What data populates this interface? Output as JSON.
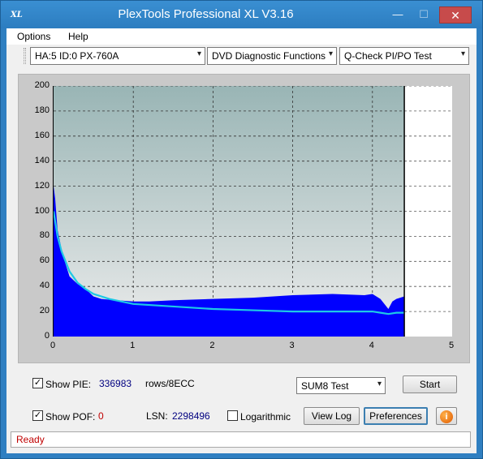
{
  "window": {
    "title": "PlexTools Professional XL V3.16",
    "icon_label": "XL",
    "min_symbol": "—",
    "max_symbol": "☐",
    "close_symbol": "✕"
  },
  "menu": {
    "items": [
      "Options",
      "Help"
    ]
  },
  "toolbar": {
    "drive": "HA:5 ID:0  PX-760A",
    "function": "DVD Diagnostic Functions",
    "test": "Q-Check PI/PO Test",
    "arrow": "▾"
  },
  "chart_data": {
    "type": "area",
    "x_ticks": [
      "0",
      "1",
      "2",
      "3",
      "4",
      "5"
    ],
    "y_ticks": [
      "0",
      "20",
      "40",
      "60",
      "80",
      "100",
      "120",
      "140",
      "160",
      "180",
      "200"
    ],
    "xlim": [
      0,
      5
    ],
    "ylim": [
      0,
      200
    ],
    "grid": true,
    "end_marker_x": 4.4,
    "series": [
      {
        "color": "#0000ff",
        "x": [
          0.0,
          0.02,
          0.05,
          0.1,
          0.15,
          0.2,
          0.3,
          0.4,
          0.5,
          0.6,
          0.8,
          1.0,
          1.2,
          1.5,
          2.0,
          2.5,
          3.0,
          3.5,
          3.9,
          4.0,
          4.1,
          4.2,
          4.25,
          4.3,
          4.4
        ],
        "values": [
          120,
          110,
          85,
          70,
          58,
          48,
          42,
          38,
          32,
          30,
          29,
          28,
          28,
          29,
          30,
          31,
          33,
          34,
          33,
          34,
          30,
          22,
          28,
          30,
          32
        ]
      },
      {
        "color": "#1ec8e6",
        "x": [
          0.0,
          0.05,
          0.1,
          0.2,
          0.3,
          0.4,
          0.5,
          0.7,
          1.0,
          1.5,
          2.0,
          2.5,
          3.0,
          3.5,
          4.0,
          4.1,
          4.2,
          4.3,
          4.4
        ],
        "values": [
          100,
          80,
          68,
          52,
          43,
          38,
          34,
          30,
          26,
          24,
          22,
          21,
          20,
          20,
          20,
          19,
          18,
          19,
          19
        ]
      }
    ]
  },
  "bottom": {
    "show_pie_label": "Show PIE:",
    "pie_value": "336983",
    "pie_unit": "rows/8ECC",
    "show_pof_label": "Show POF:",
    "pof_value": "0",
    "lsn_label": "LSN:",
    "lsn_value": "2298496",
    "logarithmic_label": "Logarithmic",
    "sum8_select": "SUM8 Test",
    "start_button": "Start",
    "view_log_button": "View Log",
    "preferences_button": "Preferences",
    "check_mark": "✓",
    "info_glyph": "i"
  },
  "status": {
    "text": "Ready"
  }
}
